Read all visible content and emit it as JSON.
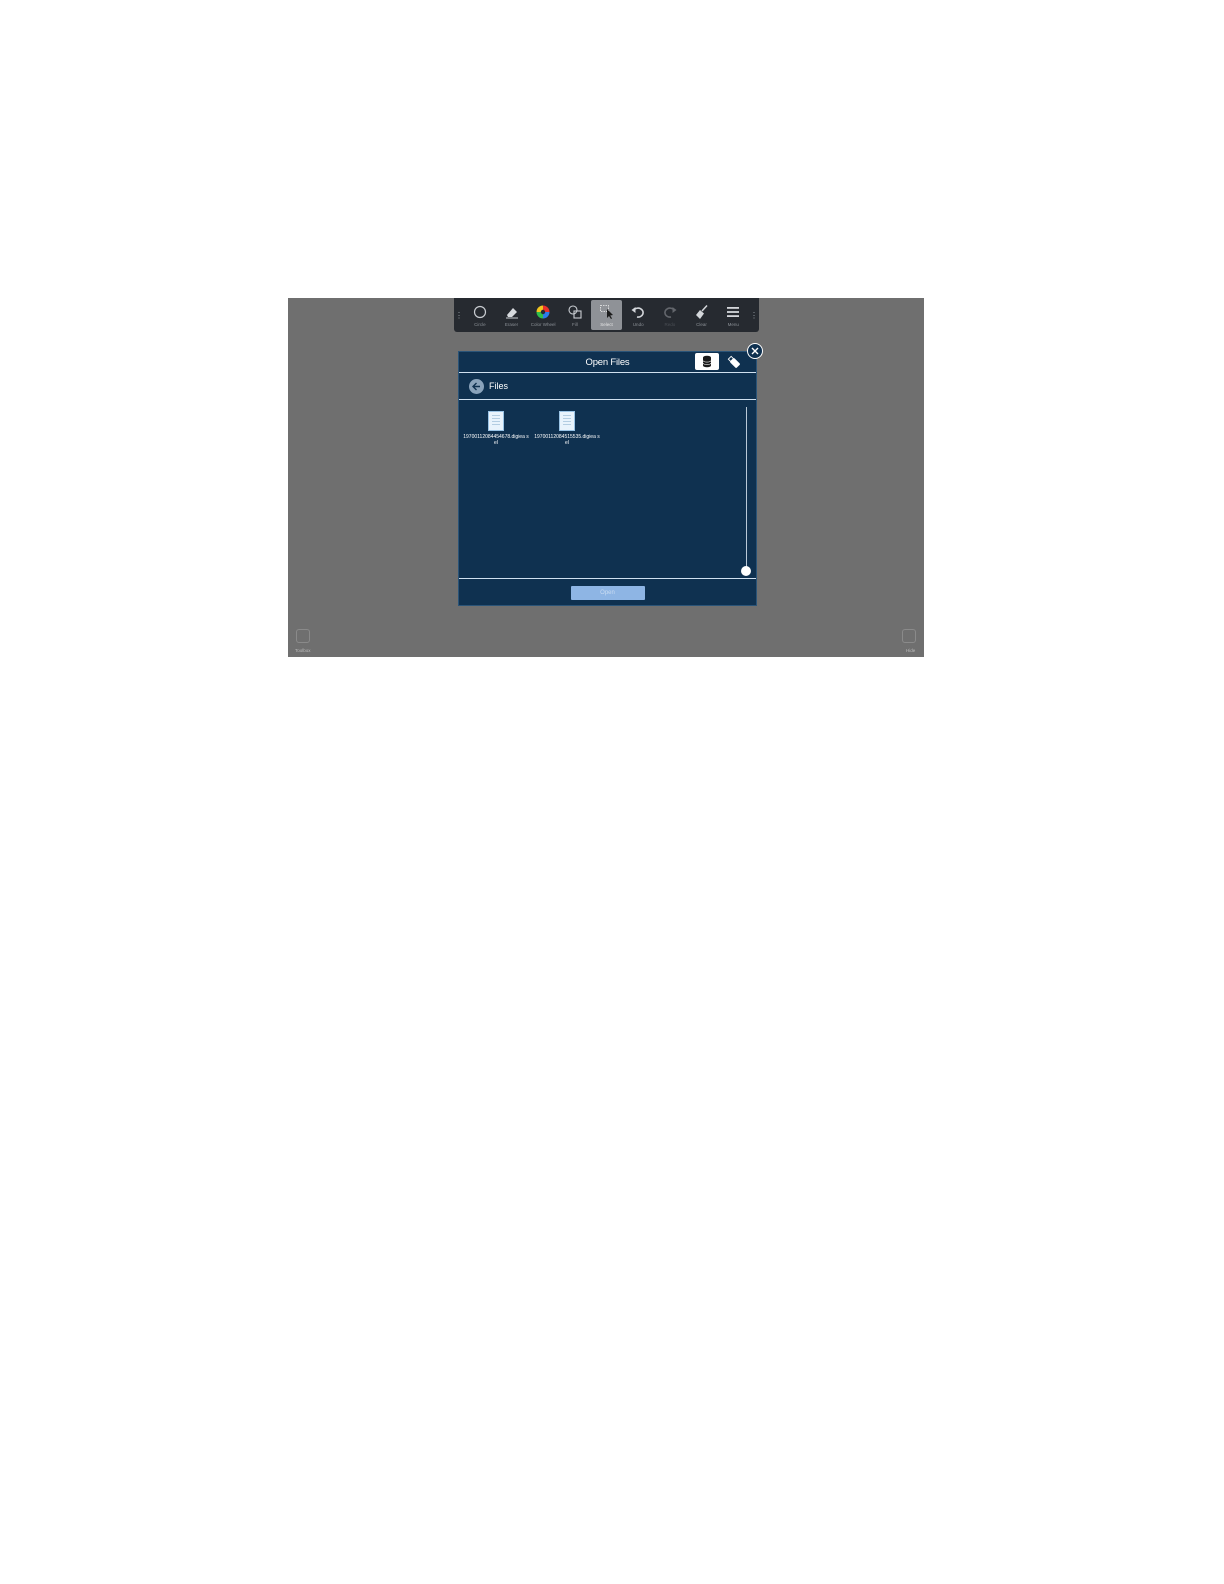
{
  "toolbar": {
    "tools": [
      {
        "label": "Circle",
        "icon": "circle-icon"
      },
      {
        "label": "Eraser",
        "icon": "eraser-icon"
      },
      {
        "label": "Color Wheel",
        "icon": "color-wheel-icon"
      },
      {
        "label": "Fill",
        "icon": "shapes-icon"
      },
      {
        "label": "Select",
        "icon": "select-pointer-icon",
        "active": true
      },
      {
        "label": "Undo",
        "icon": "undo-icon"
      },
      {
        "label": "Redo",
        "icon": "redo-icon",
        "disabled": true
      },
      {
        "label": "Clear",
        "icon": "broom-icon"
      },
      {
        "label": "Menu",
        "icon": "hamburger-icon"
      }
    ]
  },
  "dialog": {
    "title": "Open Files",
    "path_label": "Files",
    "files": [
      {
        "name": "19700112084454678.digiea sel"
      },
      {
        "name": "19700112084515535.digiea sel"
      }
    ],
    "open_label": "Open"
  },
  "corners": {
    "left_label": "Toolbox",
    "right_label": "Hide"
  },
  "colors": {
    "dialog_bg": "#0f3150",
    "backdrop": "#6f6f6f",
    "toolbar_bg": "#262a30",
    "open_button": "#8eb5e4"
  }
}
